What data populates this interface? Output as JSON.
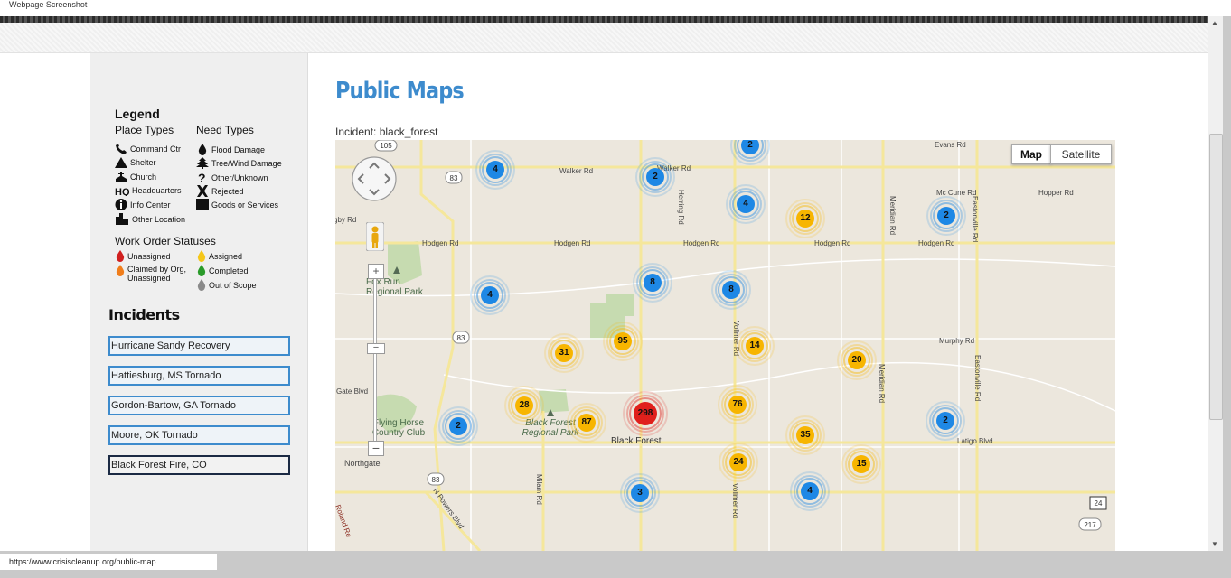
{
  "window": {
    "title": "Webpage Screenshot"
  },
  "status_url": "https://www.crisiscleanup.org/public-map",
  "legend": {
    "title": "Legend",
    "place_types_title": "Place Types",
    "place_types": [
      "Command Ctr",
      "Shelter",
      "Church",
      "Headquarters",
      "Info Center",
      "Other Location"
    ],
    "need_types_title": "Need Types",
    "need_types": [
      "Flood Damage",
      "Tree/Wind Damage",
      "Other/Unknown",
      "Rejected",
      "Goods or Services"
    ],
    "work_order_title": "Work Order Statuses",
    "statuses": [
      {
        "label": "Unassigned",
        "color": "#d0201f"
      },
      {
        "label": "Claimed by Org, Unassigned",
        "color": "#f07d1b"
      },
      {
        "label": "Assigned",
        "color": "#f5c71a"
      },
      {
        "label": "Completed",
        "color": "#2a9b2a"
      },
      {
        "label": "Out of Scope",
        "color": "#8a8a8a"
      }
    ]
  },
  "incidents": {
    "title": "Incidents",
    "items": [
      "Hurricane Sandy Recovery",
      "Hattiesburg, MS Tornado",
      "Gordon-Bartow, GA Tornado",
      "Moore, OK Tornado",
      "Black Forest Fire, CO"
    ],
    "selected": "Black Forest Fire, CO"
  },
  "main": {
    "title": "Public Maps",
    "incident_label": "Incident:",
    "incident_value": "black_forest"
  },
  "map": {
    "map_button": "Map",
    "satellite_button": "Satellite",
    "colors": {
      "blue": "#1e88e5",
      "yellow": "#f7b500",
      "red": "#e0201c",
      "road": "#f5e79b",
      "park": "#c6dbb0"
    },
    "road_labels": {
      "walker_rd_1": "Walker Rd",
      "walker_rd_2": "Walker Rd",
      "evans_rd": "Evans Rd",
      "mc_cune_rd": "Mc Cune Rd",
      "hopper_rd": "Hopper Rd",
      "hodgen_rd_1": "Hodgen Rd",
      "hodgen_rd_2": "Hodgen Rd",
      "hodgen_rd_3": "Hodgen Rd",
      "hodgen_rd_4": "Hodgen Rd",
      "hodgen_rd_5": "Hodgen Rd",
      "murphy_rd": "Murphy Rd",
      "latigo_blvd": "Latigo Blvd",
      "gate_blvd": "Gate Blvd",
      "herring_rd": "Herring Rd",
      "meridian_rd_1": "Meridian Rd",
      "meridian_rd_2": "Meridian Rd",
      "eastonville_rd_1": "Eastonville Rd",
      "eastonville_rd_2": "Eastonville Rd",
      "vollmer_rd_1": "Vollmer Rd",
      "vollmer_rd_2": "Vollmer Rd",
      "milam_rd": "Milam Rd",
      "n_powers_blvd": "N Powers Blvd",
      "roland_re": "Roland Re",
      "gby_rd": "gby Rd",
      "fox_run": "Fox Run Regional Park",
      "black_forest_park": "Black Forest Regional Park",
      "flying_horse": "Flying Horse Country Club",
      "black_forest": "Black Forest",
      "northgate": "Northgate"
    },
    "shields": {
      "s105": "105",
      "s83a": "83",
      "s83b": "83",
      "s83c": "83",
      "s24": "24",
      "s217": "217"
    },
    "clusters": [
      {
        "count": "4",
        "color": "blue"
      },
      {
        "count": "2",
        "color": "blue"
      },
      {
        "count": "2",
        "color": "blue"
      },
      {
        "count": "4",
        "color": "blue"
      },
      {
        "count": "12",
        "color": "yellow"
      },
      {
        "count": "2",
        "color": "blue"
      },
      {
        "count": "4",
        "color": "blue"
      },
      {
        "count": "8",
        "color": "blue"
      },
      {
        "count": "8",
        "color": "blue"
      },
      {
        "count": "31",
        "color": "yellow"
      },
      {
        "count": "95",
        "color": "yellow"
      },
      {
        "count": "14",
        "color": "yellow"
      },
      {
        "count": "20",
        "color": "yellow"
      },
      {
        "count": "28",
        "color": "yellow"
      },
      {
        "count": "87",
        "color": "yellow"
      },
      {
        "count": "298",
        "color": "red"
      },
      {
        "count": "76",
        "color": "yellow"
      },
      {
        "count": "2",
        "color": "blue"
      },
      {
        "count": "2",
        "color": "blue"
      },
      {
        "count": "35",
        "color": "yellow"
      },
      {
        "count": "24",
        "color": "yellow"
      },
      {
        "count": "15",
        "color": "yellow"
      },
      {
        "count": "3",
        "color": "blue"
      },
      {
        "count": "4",
        "color": "blue"
      }
    ]
  }
}
